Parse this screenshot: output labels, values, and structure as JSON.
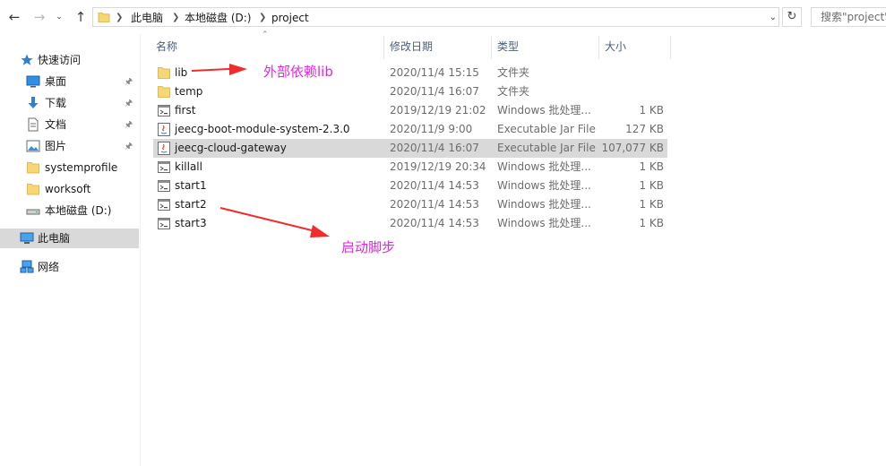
{
  "breadcrumbs": [
    "此电脑",
    "本地磁盘 (D:)",
    "project"
  ],
  "search_placeholder": "搜索\"project\"",
  "nav": {
    "quick_access": "快速访问",
    "items": [
      {
        "label": "桌面",
        "icon": "desktop-icon",
        "pinned": true
      },
      {
        "label": "下载",
        "icon": "download-icon",
        "pinned": true
      },
      {
        "label": "文档",
        "icon": "document-icon",
        "pinned": true
      },
      {
        "label": "图片",
        "icon": "picture-icon",
        "pinned": true
      },
      {
        "label": "systemprofile",
        "icon": "folder-icon",
        "pinned": false
      },
      {
        "label": "worksoft",
        "icon": "folder-icon",
        "pinned": false
      },
      {
        "label": "本地磁盘 (D:)",
        "icon": "drive-icon",
        "pinned": false
      }
    ],
    "this_pc": "此电脑",
    "network": "网络"
  },
  "columns": {
    "name": "名称",
    "date": "修改日期",
    "type": "类型",
    "size": "大小"
  },
  "files": [
    {
      "name": "lib",
      "date": "2020/11/4 15:15",
      "type": "文件夹",
      "size": "",
      "kind": "folder"
    },
    {
      "name": "temp",
      "date": "2020/11/4 16:07",
      "type": "文件夹",
      "size": "",
      "kind": "folder"
    },
    {
      "name": "first",
      "date": "2019/12/19 21:02",
      "type": "Windows 批处理...",
      "size": "1 KB",
      "kind": "bat"
    },
    {
      "name": "jeecg-boot-module-system-2.3.0",
      "date": "2020/11/9 9:00",
      "type": "Executable Jar File",
      "size": "127 KB",
      "kind": "jar"
    },
    {
      "name": "jeecg-cloud-gateway",
      "date": "2020/11/4 16:07",
      "type": "Executable Jar File",
      "size": "107,077 KB",
      "kind": "jar",
      "selected": true
    },
    {
      "name": "killall",
      "date": "2019/12/19 20:34",
      "type": "Windows 批处理...",
      "size": "1 KB",
      "kind": "bat"
    },
    {
      "name": "start1",
      "date": "2020/11/4 14:53",
      "type": "Windows 批处理...",
      "size": "1 KB",
      "kind": "bat"
    },
    {
      "name": "start2",
      "date": "2020/11/4 14:53",
      "type": "Windows 批处理...",
      "size": "1 KB",
      "kind": "bat"
    },
    {
      "name": "start3",
      "date": "2020/11/4 14:53",
      "type": "Windows 批处理...",
      "size": "1 KB",
      "kind": "bat"
    }
  ],
  "annotations": {
    "lib": "外部依赖lib",
    "start": "启动脚步"
  },
  "colors": {
    "annotation": "#e623e6",
    "arrow": "#f02c2c",
    "folder": "#f7d774",
    "selected_row": "#d9d9d9"
  }
}
